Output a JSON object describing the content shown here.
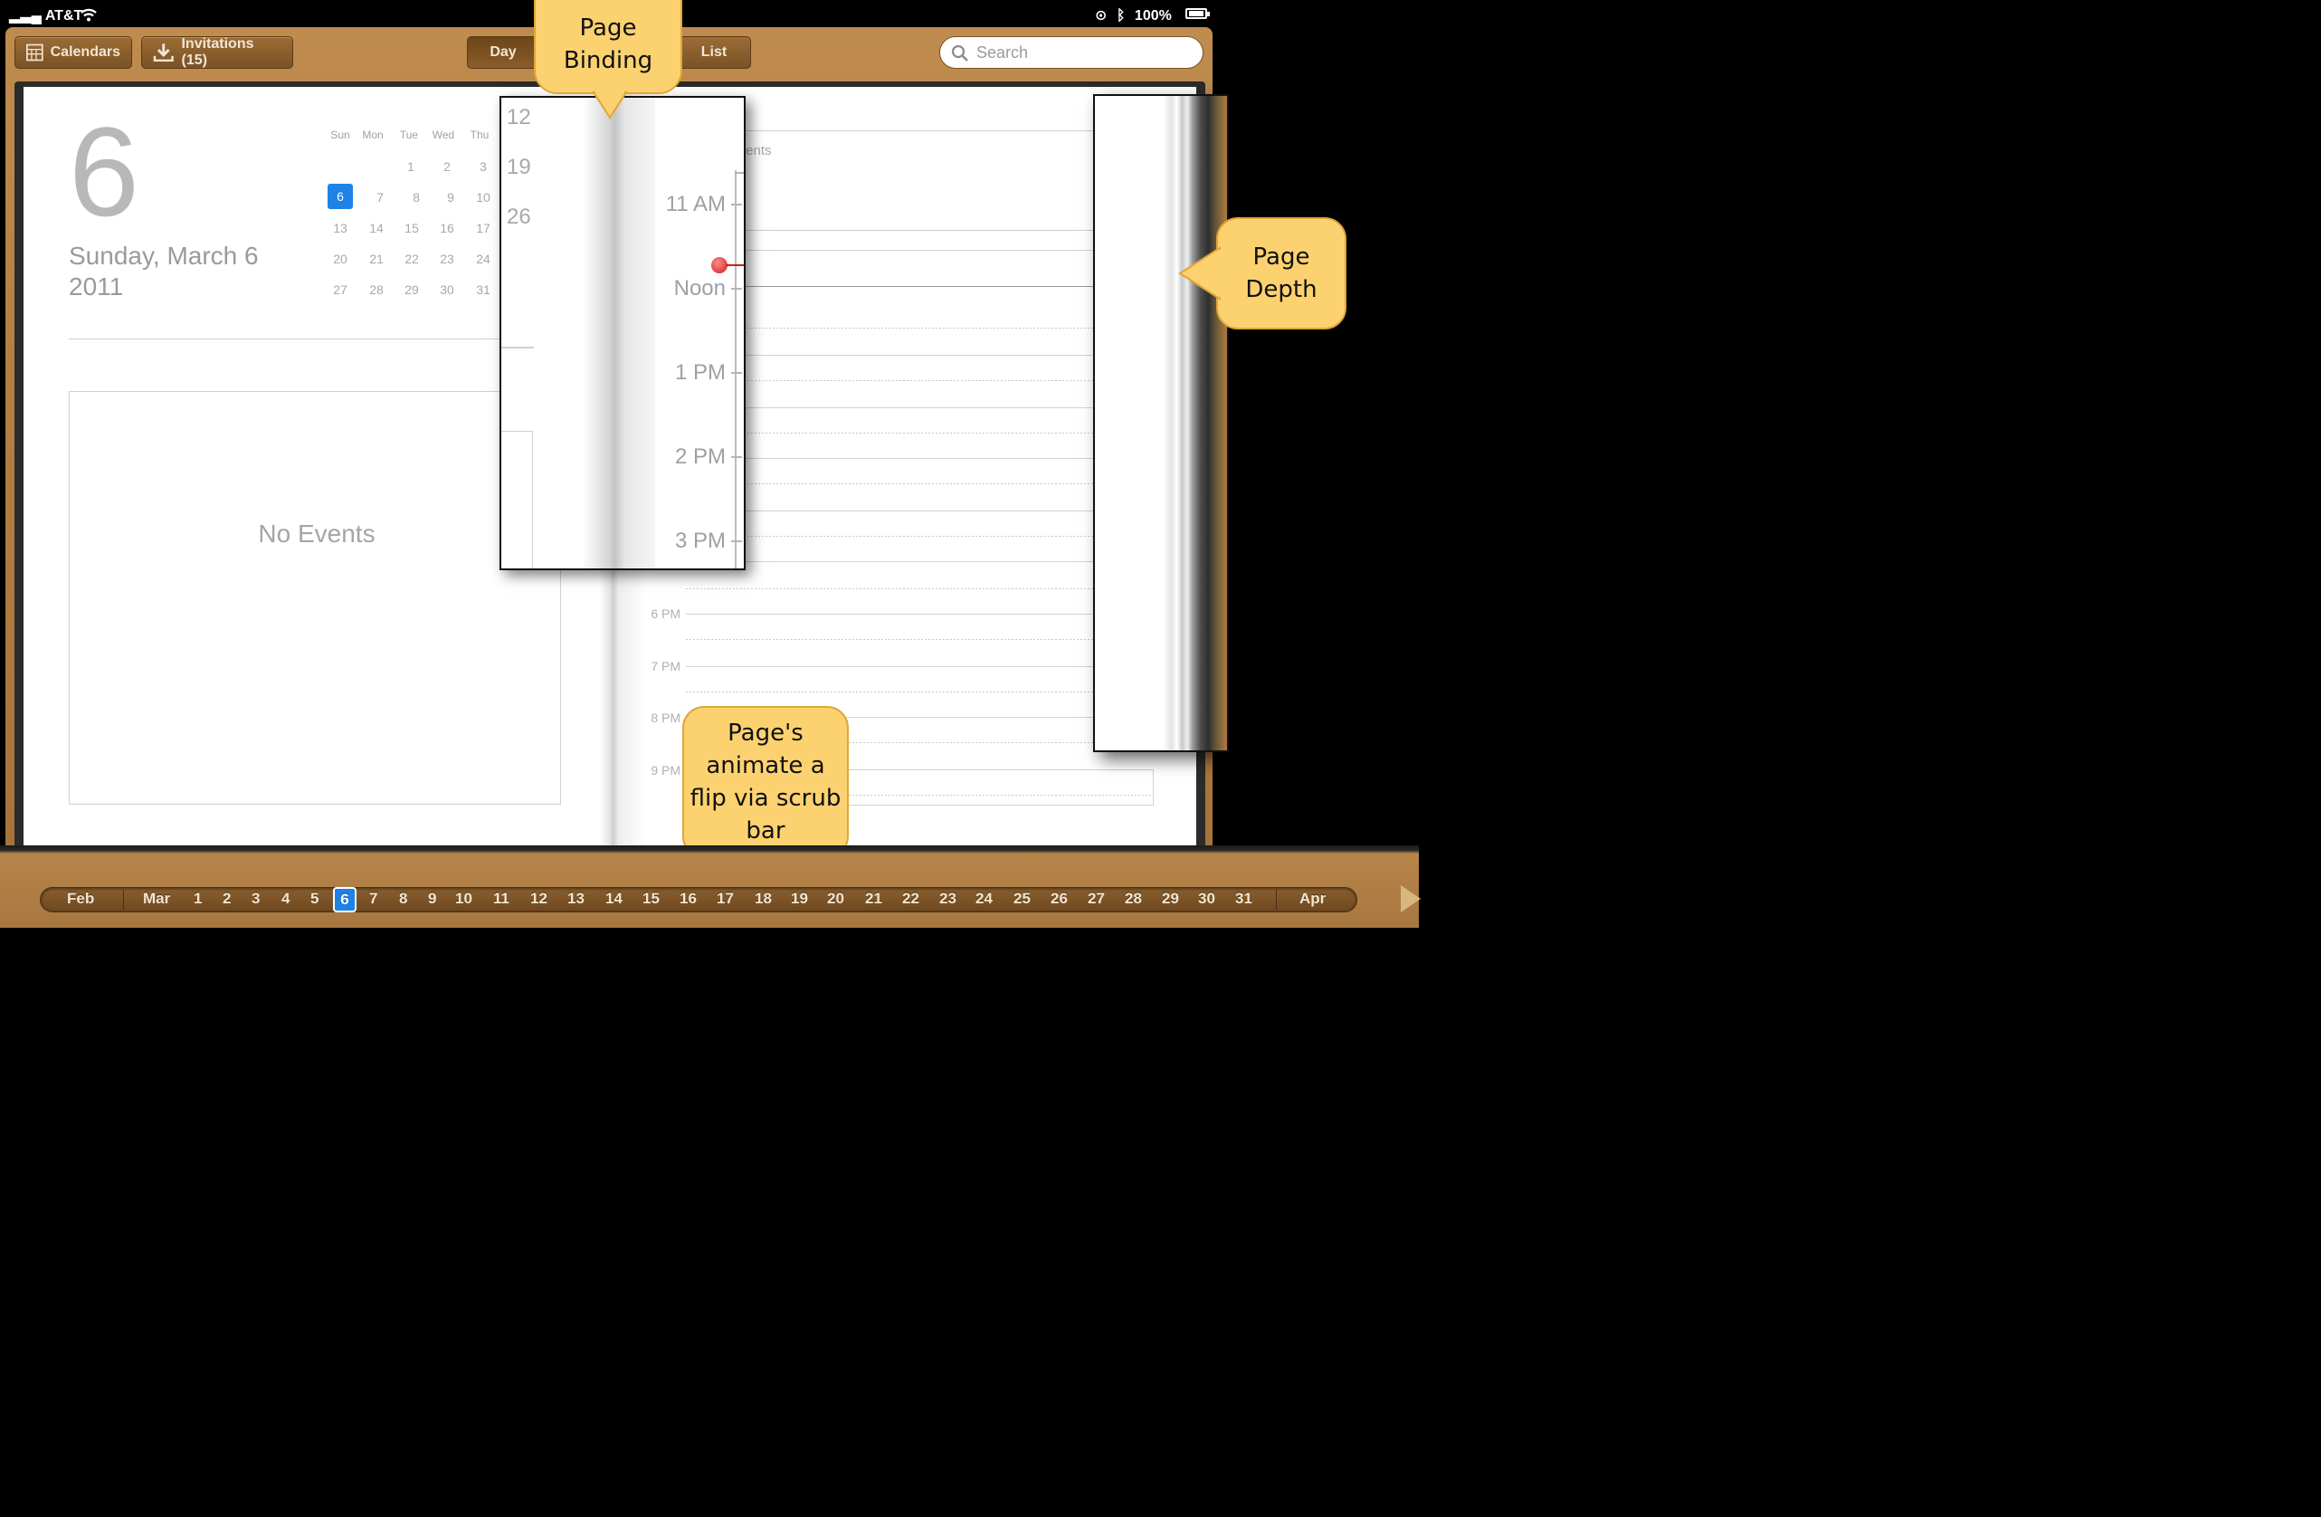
{
  "status_bar": {
    "carrier": "AT&T",
    "battery": "100%"
  },
  "toolbar": {
    "calendars_label": "Calendars",
    "invitations_label": "Invitations (15)",
    "view_day": "Day",
    "view_list": "List",
    "search_placeholder": "Search"
  },
  "day_page": {
    "day_number": "6",
    "date_line": "Sunday, March 6",
    "year": "2011",
    "no_events": "No Events",
    "all_day_events": "all-day events"
  },
  "mini_calendar": {
    "weekday_headers": [
      "Sun",
      "Mon",
      "Tue",
      "Wed",
      "Thu"
    ],
    "rows": [
      [
        "",
        "",
        "1",
        "2",
        "3"
      ],
      [
        "6",
        "7",
        "8",
        "9",
        "10"
      ],
      [
        "13",
        "14",
        "15",
        "16",
        "17"
      ],
      [
        "20",
        "21",
        "22",
        "23",
        "24"
      ],
      [
        "27",
        "28",
        "29",
        "30",
        "31"
      ]
    ],
    "selected": "6"
  },
  "timeline": {
    "hours": [
      "6 PM",
      "7 PM",
      "8 PM",
      "9 PM"
    ]
  },
  "zoom_binding": {
    "week_numbers": [
      "12",
      "19",
      "26"
    ],
    "hours": [
      "11 AM",
      "Noon",
      "1 PM",
      "2 PM",
      "3 PM"
    ]
  },
  "callouts": {
    "binding": [
      "Page",
      "Binding"
    ],
    "depth": [
      "Page",
      "Depth"
    ],
    "scrub": [
      "Page's",
      "animate a",
      "flip via scrub",
      "bar"
    ]
  },
  "scrub_bar": {
    "prev_month": "Feb",
    "month": "Mar",
    "days": [
      "1",
      "2",
      "3",
      "4",
      "5",
      "6",
      "7",
      "8",
      "9",
      "10",
      "11",
      "12",
      "13",
      "14",
      "15",
      "16",
      "17",
      "18",
      "19",
      "20",
      "21",
      "22",
      "23",
      "24",
      "25",
      "26",
      "27",
      "28",
      "29",
      "30",
      "31"
    ],
    "selected_day": "6",
    "next_month": "Apr"
  },
  "colors": {
    "accent_blue": "#1e82e6",
    "callout_fill": "#fcd270",
    "leather": "#b27f43",
    "now_marker": "#d11d1d"
  }
}
